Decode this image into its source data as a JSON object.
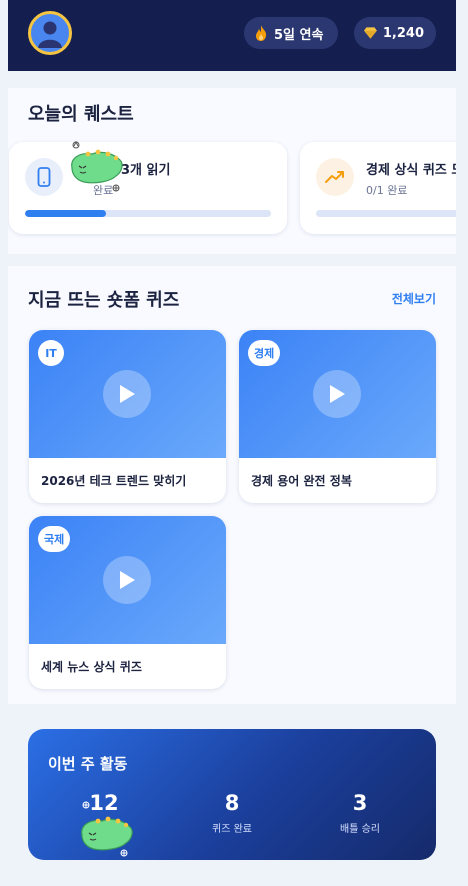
{
  "header": {
    "avatar_icon": "user-icon",
    "streak": {
      "icon": "flame-icon",
      "label": "5일 연속"
    },
    "gems": {
      "icon": "gem-icon",
      "label": "1,240"
    }
  },
  "quests": {
    "title": "오늘의 퀘스트",
    "items": [
      {
        "icon": "phone-icon",
        "title": "3개 읽기",
        "subtitle": "완료",
        "progress": 0.33
      },
      {
        "icon": "trending-up-icon",
        "title": "경제 상식 퀴즈 도",
        "subtitle": "0/1 완료",
        "progress": 0
      }
    ]
  },
  "quizzes": {
    "title": "지금 뜨는 숏폼 퀴즈",
    "see_all": "전체보기",
    "items": [
      {
        "tag": "IT",
        "title": "2026년 테크 트렌드 맞히기"
      },
      {
        "tag": "경제",
        "title": "경제 용어 완전 정복"
      },
      {
        "tag": "국제",
        "title": "세계 뉴스 상식 퀴즈"
      }
    ]
  },
  "weekly": {
    "title": "이번 주 활동",
    "stats": [
      {
        "value": "12",
        "label": ""
      },
      {
        "value": "8",
        "label": "퀴즈 완료"
      },
      {
        "value": "3",
        "label": "배틀 승리"
      }
    ]
  },
  "colors": {
    "header_bg": "#141f4f",
    "accent": "#2f7ff1",
    "gem": "#f5c542",
    "flame": "#f59e0b"
  }
}
